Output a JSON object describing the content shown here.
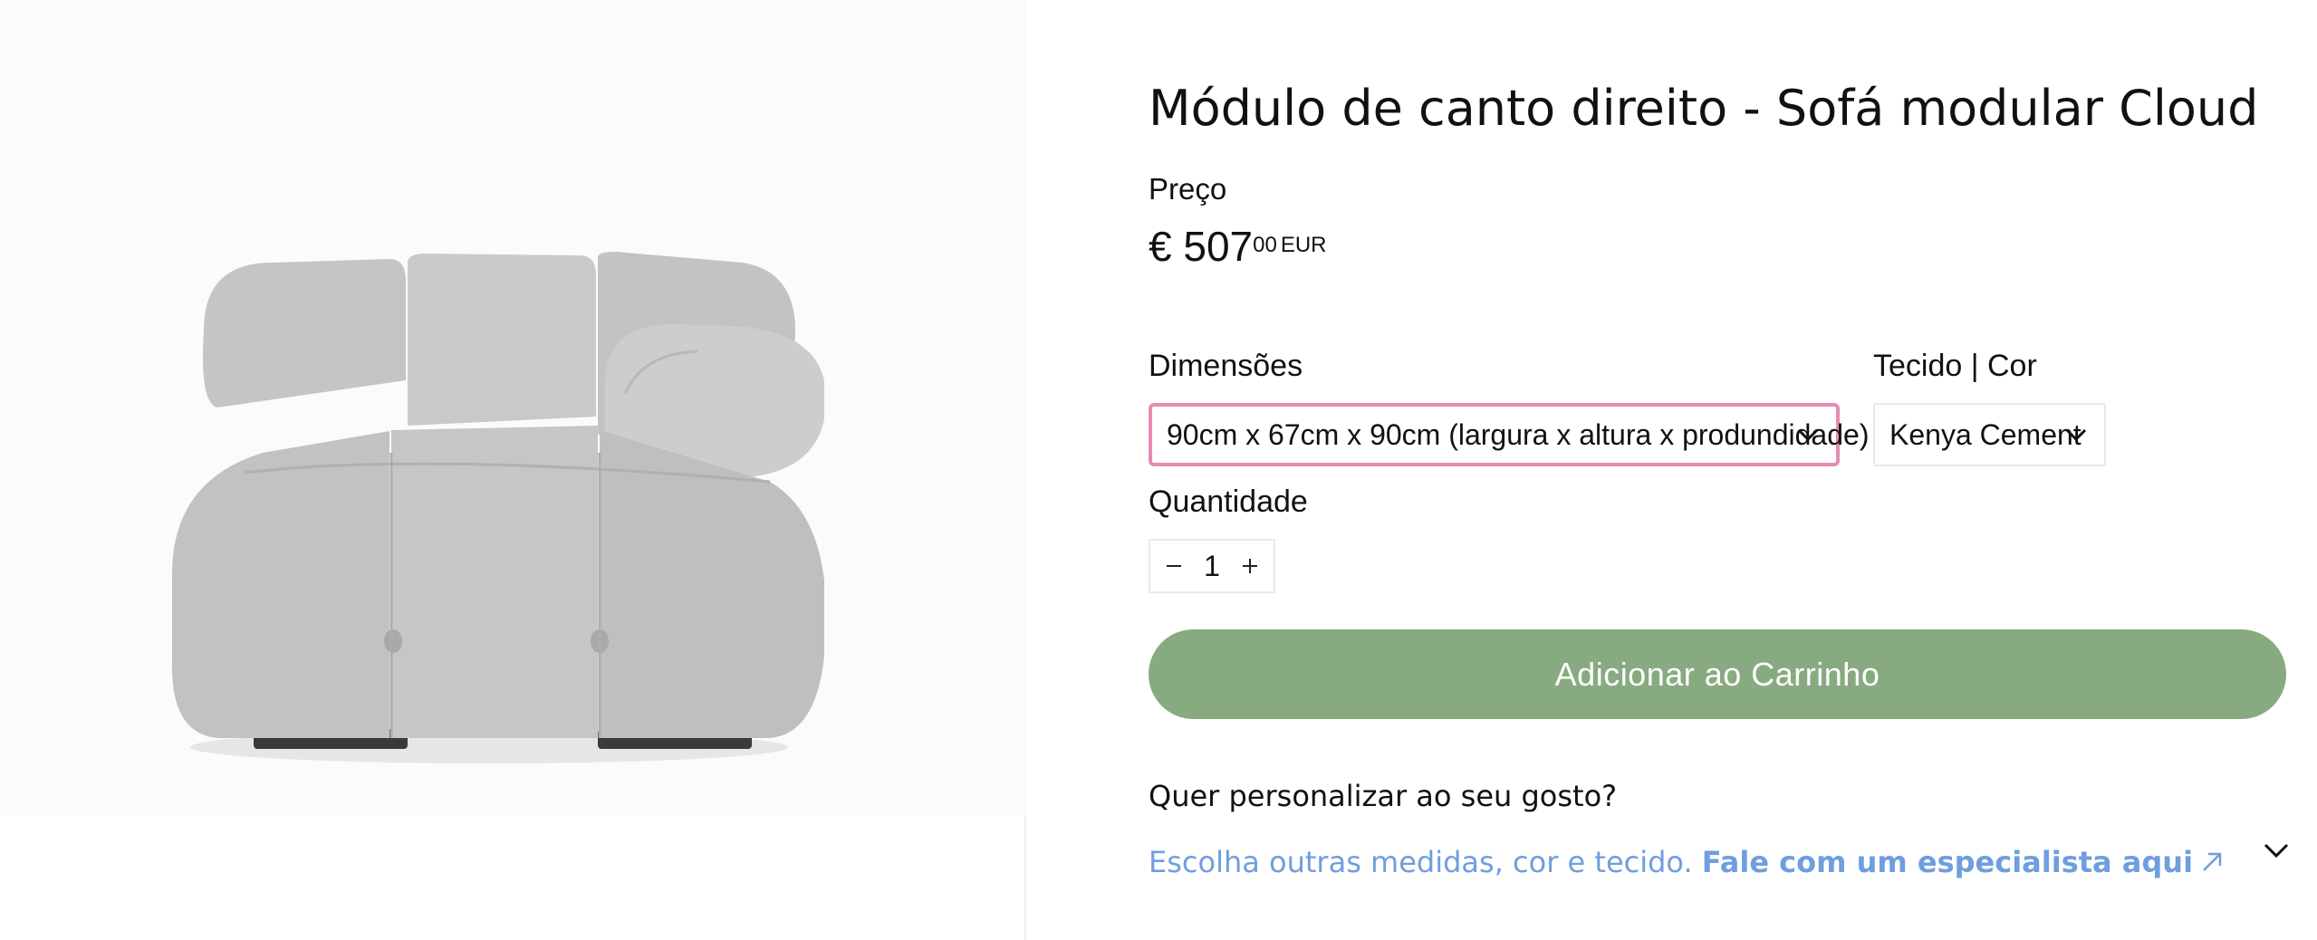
{
  "product": {
    "title": "Módulo de canto direito - Sofá modular Cloud",
    "price_label": "Preço",
    "price_main": "€ 507",
    "price_cents": "00",
    "price_currency": "EUR",
    "image_name": "sofa-corner-module-image"
  },
  "options": {
    "dimensions_label": "Dimensões",
    "dimensions_value": "90cm x 67cm x 90cm (largura x altura x produndidade)",
    "fabric_label": "Tecido | Cor",
    "fabric_value": "Kenya Cement",
    "quantity_label": "Quantidade",
    "quantity_value": "1"
  },
  "cart": {
    "add_label": "Adicionar ao Carrinho"
  },
  "customize": {
    "title": "Quer personalizar ao seu gosto?",
    "text": "Escolha outras medidas, cor e tecido.",
    "link_text": "Fale com um especialista aqui"
  },
  "icons": {
    "chevron": "chevron-down-icon",
    "minus": "minus-icon",
    "plus": "plus-icon",
    "external": "external-link-arrow-icon"
  },
  "colors": {
    "accent_button": "#88aa80",
    "select_focus_border": "#e58cb4",
    "link": "#6f9ede"
  }
}
